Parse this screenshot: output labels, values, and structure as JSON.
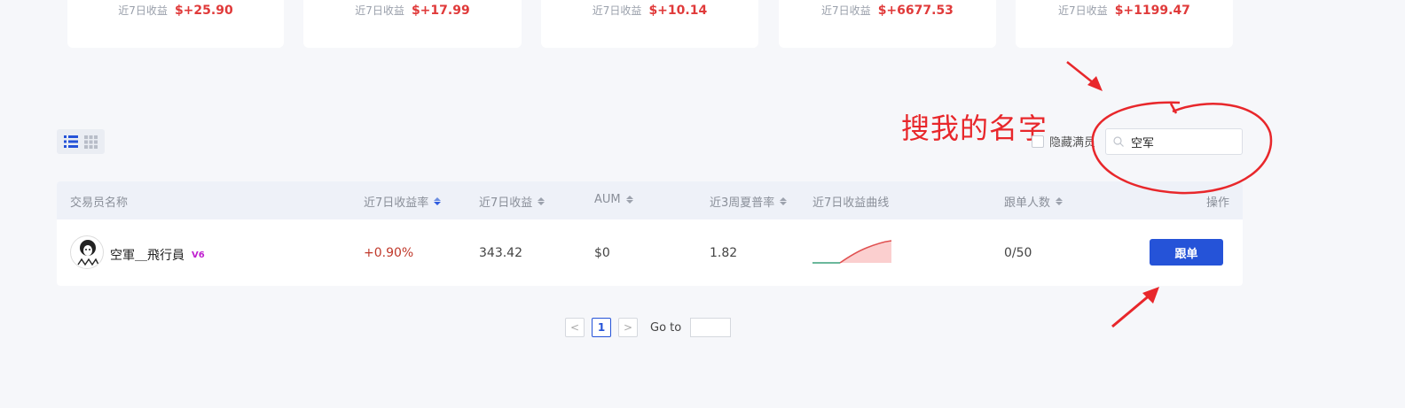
{
  "top_cards": [
    {
      "label": "近7日收益",
      "value": "$+25.90"
    },
    {
      "label": "近7日收益",
      "value": "$+17.99"
    },
    {
      "label": "近7日收益",
      "value": "$+10.14"
    },
    {
      "label": "近7日收益",
      "value": "$+6677.53"
    },
    {
      "label": "近7日收益",
      "value": "$+1199.47"
    }
  ],
  "annotation": {
    "text": "搜我的名字"
  },
  "filters": {
    "hide_full_label": "隐藏满员"
  },
  "search": {
    "value": "空军",
    "icon": "search-icon"
  },
  "table": {
    "headers": {
      "name": "交易员名称",
      "rate7": "近7日收益率",
      "profit7": "近7日收益",
      "aum": "AUM",
      "sharpe": "近3周夏普率",
      "curve": "近7日收益曲线",
      "followers": "跟单人数",
      "action": "操作"
    },
    "rows": [
      {
        "name": "空軍＿飛行員",
        "badge": "V6",
        "rate7": "+0.90%",
        "profit7": "343.42",
        "aum": "$0",
        "sharpe": "1.82",
        "followers": "0/50",
        "action_label": "跟单"
      }
    ]
  },
  "pagination": {
    "current": "1",
    "prev": "<",
    "next": ">",
    "goto_label": "Go to"
  },
  "colors": {
    "accent": "#2553d8",
    "profit": "#e03a3a",
    "annotation": "#e8272b"
  }
}
